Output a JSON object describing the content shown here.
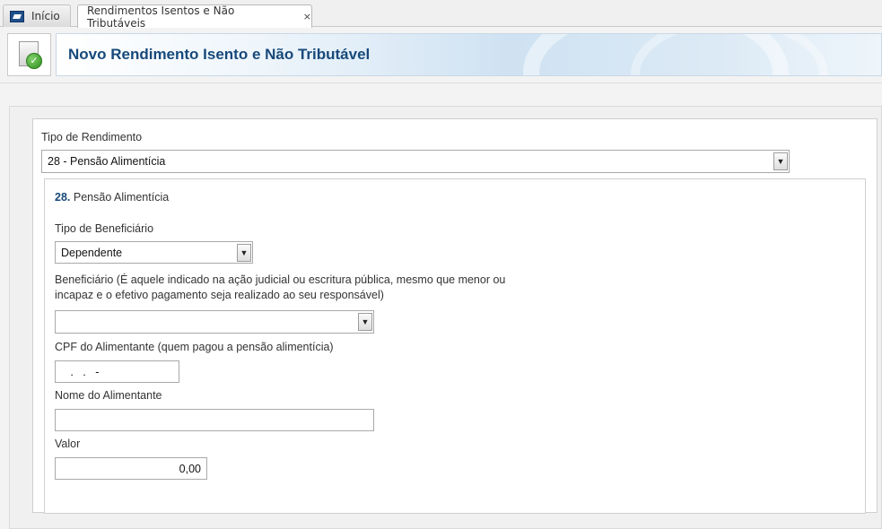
{
  "tabs": {
    "home_label": "Início",
    "active_label": "Rendimentos Isentos e Não Tributáveis",
    "close_symbol": "×"
  },
  "header": {
    "title": "Novo Rendimento Isento e Não Tributável",
    "icon": "document-check-icon"
  },
  "form": {
    "tipo_rendimento_label": "Tipo de Rendimento",
    "tipo_rendimento_value": "28 - Pensão Alimentícia",
    "section_number": "28.",
    "section_title": "Pensão Alimentícia",
    "tipo_beneficiario_label": "Tipo de Beneficiário",
    "tipo_beneficiario_value": "Dependente",
    "beneficiario_label_line1": "Beneficiário (É aquele indicado na ação judicial ou escritura pública, mesmo que menor ou",
    "beneficiario_label_line2": "incapaz e o efetivo pagamento seja realizado ao seu responsável)",
    "beneficiario_value": "",
    "cpf_label": "CPF do Alimentante (quem pagou a pensão alimentícia)",
    "cpf_value": "   .   .   -",
    "nome_label": "Nome do Alimentante",
    "nome_value": "",
    "valor_label": "Valor",
    "valor_value": "0,00",
    "dropdown_arrow": "▼"
  },
  "colors": {
    "title_blue": "#17497a",
    "border_gray": "#a9a9a9"
  }
}
